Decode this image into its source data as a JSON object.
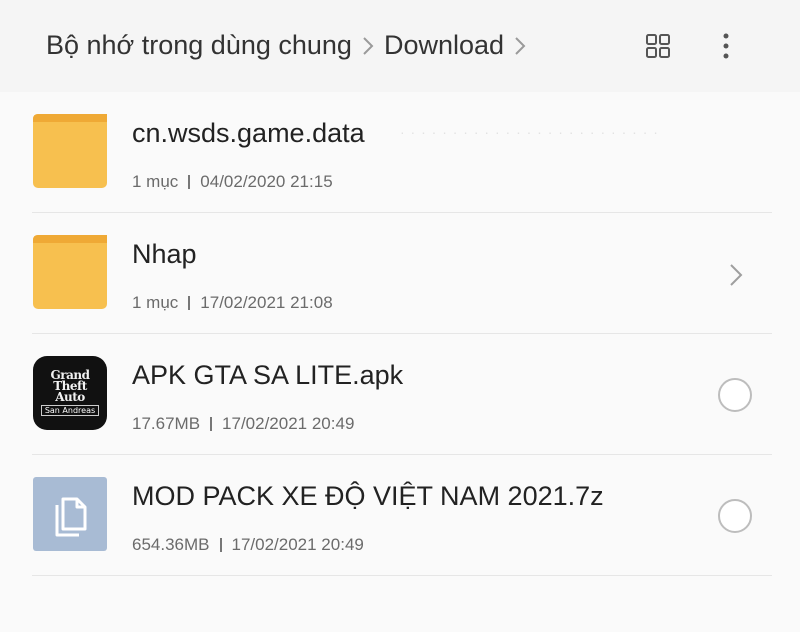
{
  "header": {
    "breadcrumb": [
      "Bộ nhớ trong dùng chung",
      "Download"
    ],
    "icons": [
      "grid-view-icon",
      "more-vertical-icon"
    ]
  },
  "colors": {
    "folder": "#f7c04f",
    "folder_tab": "#efa935",
    "file_generic_bg": "#a8bbd4",
    "text_primary": "#222222",
    "text_secondary": "#6b6b6b"
  },
  "files": [
    {
      "name": "cn.wsds.game.data",
      "type": "folder",
      "count": "1 mục",
      "date": "04/02/2020 21:15",
      "icon": "folder-icon"
    },
    {
      "name": "Nhap",
      "type": "folder",
      "count": "1 mục",
      "date": "17/02/2021 21:08",
      "icon": "folder-icon"
    },
    {
      "name": "APK GTA SA LITE.apk",
      "type": "apk",
      "size": "17.67MB",
      "date": "17/02/2021 20:49",
      "icon": "gta-app-icon",
      "logo_lines": [
        "Grand",
        "Theft",
        "Auto"
      ],
      "logo_sub": "San Andreas"
    },
    {
      "name": "MOD PACK XE ĐỘ VIỆT NAM 2021.7z",
      "type": "file",
      "size": "654.36MB",
      "date": "17/02/2021 20:49",
      "icon": "document-icon"
    }
  ]
}
